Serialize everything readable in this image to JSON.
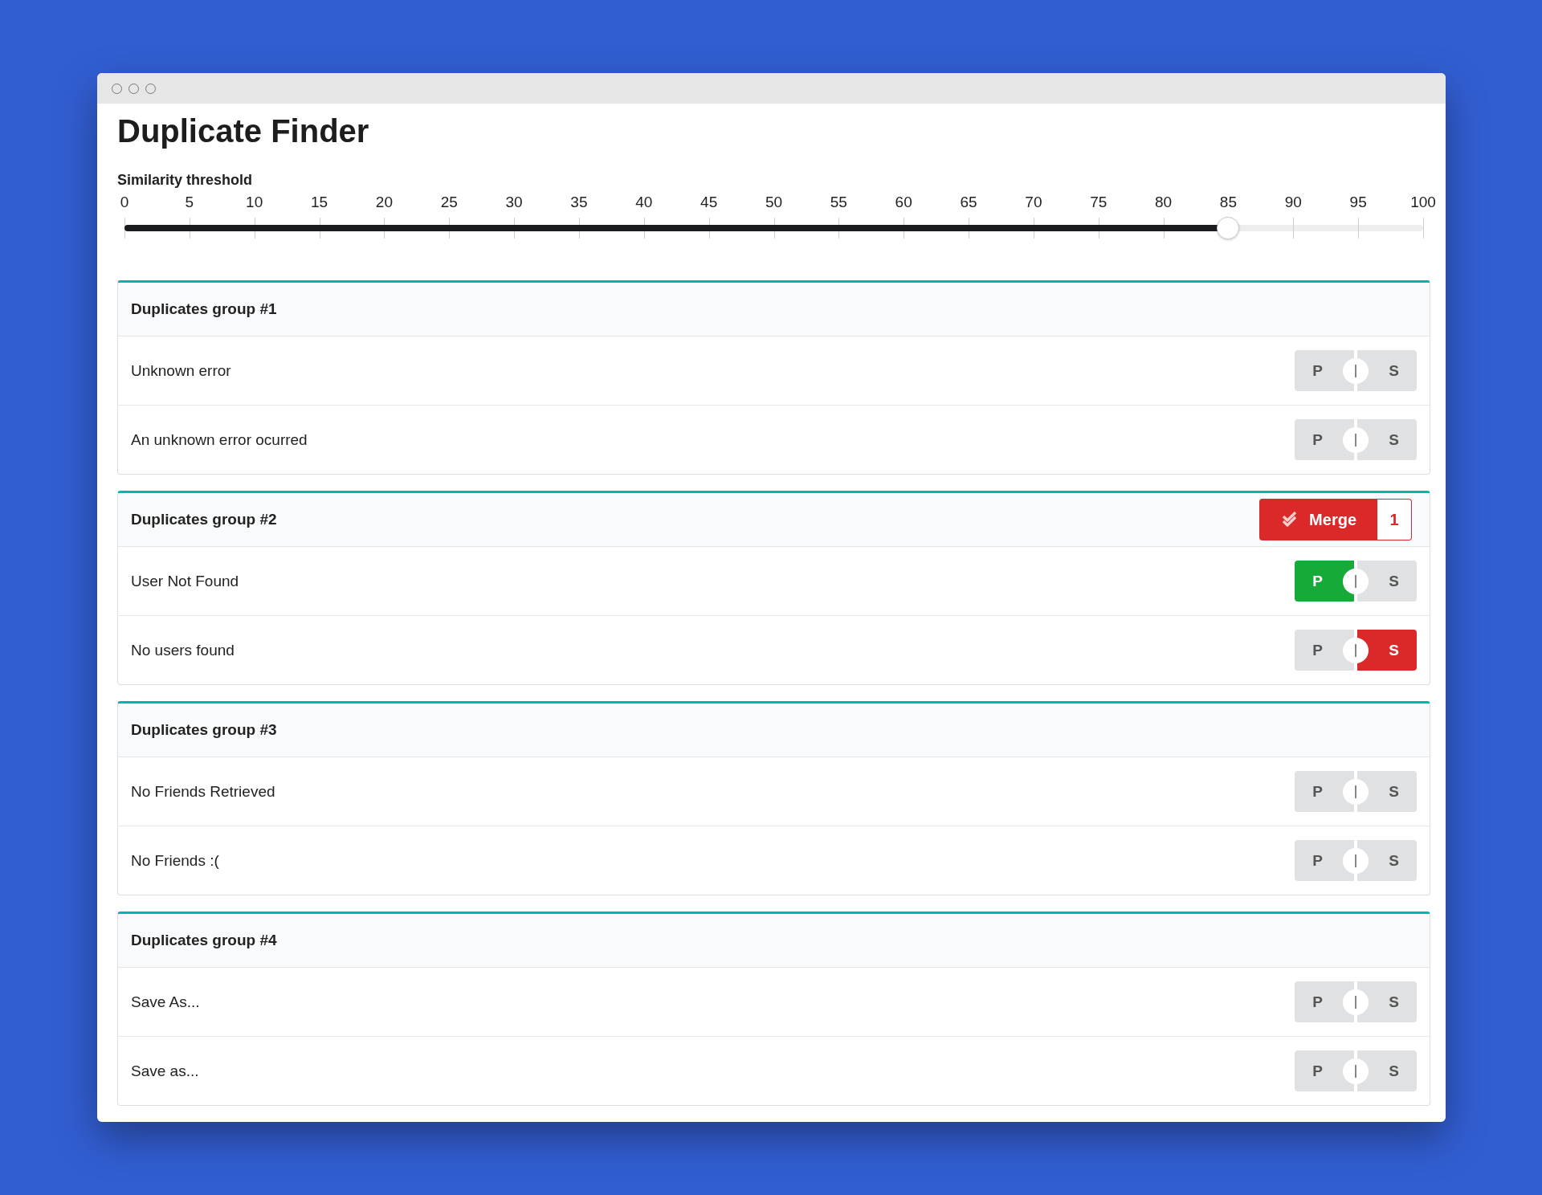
{
  "window": {
    "title": "Duplicate Finder"
  },
  "slider": {
    "label": "Similarity threshold",
    "level": 0.85,
    "ticks": [
      "0",
      "5",
      "10",
      "15",
      "20",
      "25",
      "30",
      "35",
      "40",
      "45",
      "50",
      "55",
      "60",
      "65",
      "70",
      "75",
      "80",
      "85",
      "90",
      "95",
      "100"
    ]
  },
  "groups": [
    {
      "title": "Duplicates group #1",
      "items": [
        {
          "label": "Unknown error",
          "primary": "P",
          "secondary": "S",
          "primary_on": false,
          "secondary_on": false
        },
        {
          "label": "An unknown error ocurred",
          "primary": "P",
          "secondary": "S",
          "primary_on": false,
          "secondary_on": false
        }
      ]
    },
    {
      "title": "Duplicates group #2",
      "merge": {
        "label": "Merge",
        "count": "1"
      },
      "items": [
        {
          "label": "User Not Found",
          "primary": "P",
          "secondary": "S",
          "primary_on": true,
          "secondary_on": false
        },
        {
          "label": "No users found",
          "primary": "P",
          "secondary": "S",
          "primary_on": false,
          "secondary_on": true
        }
      ]
    },
    {
      "title": "Duplicates group #3",
      "items": [
        {
          "label": "No Friends Retrieved",
          "primary": "P",
          "secondary": "S",
          "primary_on": false,
          "secondary_on": false
        },
        {
          "label": "No Friends :(",
          "primary": "P",
          "secondary": "S",
          "primary_on": false,
          "secondary_on": false
        }
      ]
    },
    {
      "title": "Duplicates group #4",
      "items": [
        {
          "label": "Save As...",
          "primary": "P",
          "secondary": "S",
          "primary_on": false,
          "secondary_on": false
        },
        {
          "label": "Save as...",
          "primary": "P",
          "secondary": "S",
          "primary_on": false,
          "secondary_on": false
        }
      ]
    }
  ]
}
